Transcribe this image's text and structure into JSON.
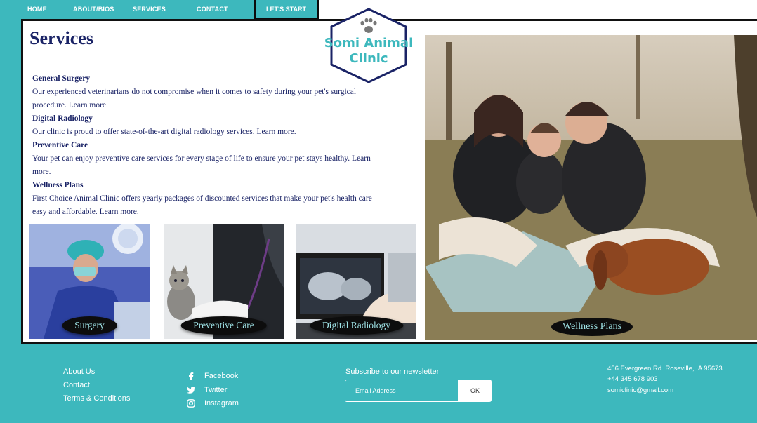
{
  "nav": {
    "items": [
      "HOME",
      "ABOUT/BIOS",
      "SERVICES",
      "CONTACT"
    ],
    "cta": "LET'S START"
  },
  "logo": {
    "line1": "Somi Animal",
    "line2": "Clinic"
  },
  "page_title": "Services",
  "services": [
    {
      "title": "General Surgery",
      "text": "Our experienced veterinarians do not compromise when it comes to safety during your pet's surgical procedure. Learn more."
    },
    {
      "title": "Digital Radiology",
      "text": "Our clinic is proud to offer state-of-the-art digital radiology services. Learn more."
    },
    {
      "title": "Preventive Care",
      "text": "Your pet can enjoy preventive care services for every stage of life to ensure your pet stays healthy. Learn more."
    },
    {
      "title": "Wellness Plans",
      "text": "First Choice Animal Clinic offers yearly packages of discounted services that make your pet's health care easy and affordable. Learn more."
    }
  ],
  "cards": [
    "Surgery",
    "Preventive Care",
    "Digital Radiology"
  ],
  "hero_label": "Wellness Plans",
  "footer": {
    "links": [
      "About Us",
      "Contact",
      "Terms & Conditions"
    ],
    "social": [
      "Facebook",
      "Twitter",
      "Instagram"
    ],
    "newsletter_title": "Subscribe to our newsletter",
    "newsletter_placeholder": "Email Address",
    "newsletter_button": "OK",
    "address": "456 Evergreen Rd. Roseville, IA 95673",
    "phone": "+44 345 678 903",
    "email": "somiclinic@gmail.com"
  },
  "colors": {
    "teal": "#3db8bd",
    "navy": "#1a2366",
    "pill": "#0d0d0d",
    "pill_text": "#9fe3e6"
  }
}
